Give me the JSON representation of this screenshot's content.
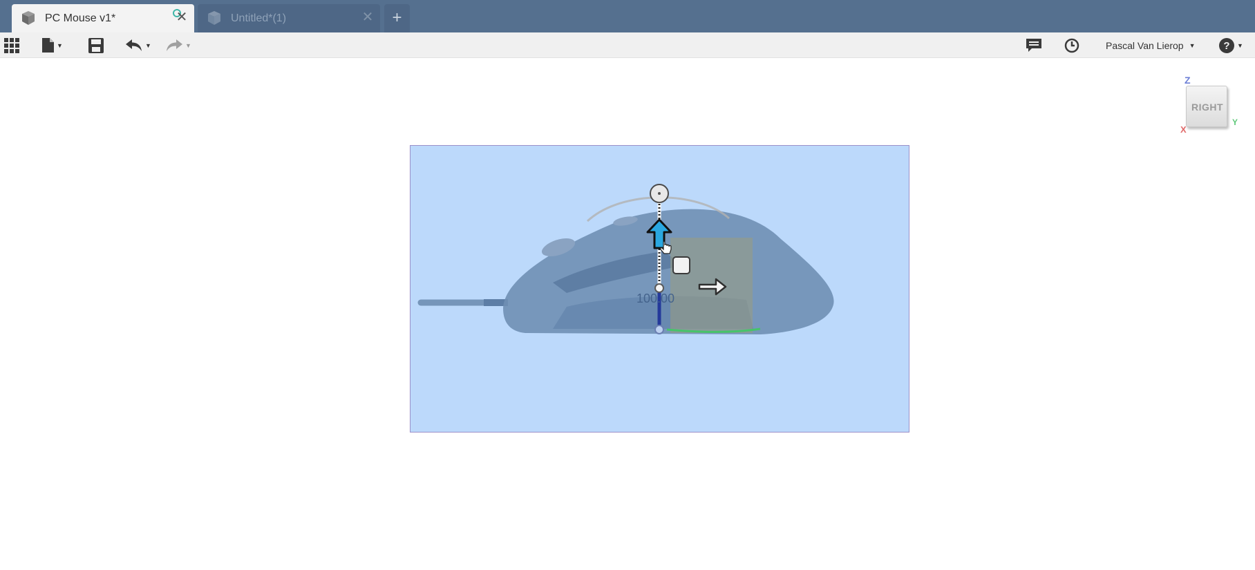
{
  "tabs": [
    {
      "title": "PC Mouse v1*",
      "active": true
    },
    {
      "title": "Untitled*(1)",
      "active": false
    }
  ],
  "new_tab_label": "+",
  "close_glyph": "✕",
  "toolbar": {
    "left_icons": [
      "apps-grid-icon",
      "file-icon",
      "save-icon",
      "undo-icon",
      "redo-icon"
    ],
    "right_icons": [
      "comments-icon",
      "history-clock-icon",
      "help-icon"
    ],
    "user_name": "Pascal Van Lierop"
  },
  "viewport": {
    "dimension_value": "100.00",
    "view_cube": {
      "face": "RIGHT",
      "axis_z": "Z",
      "axis_y": "Y",
      "axis_x": "X"
    }
  },
  "colors": {
    "tabbar": "#55708f",
    "selection_fill": "#bcd9fb",
    "mouse_body": "#6f8fb4",
    "move_arrow": "#2aa7e0",
    "status_ring": "#3fb6a8"
  }
}
